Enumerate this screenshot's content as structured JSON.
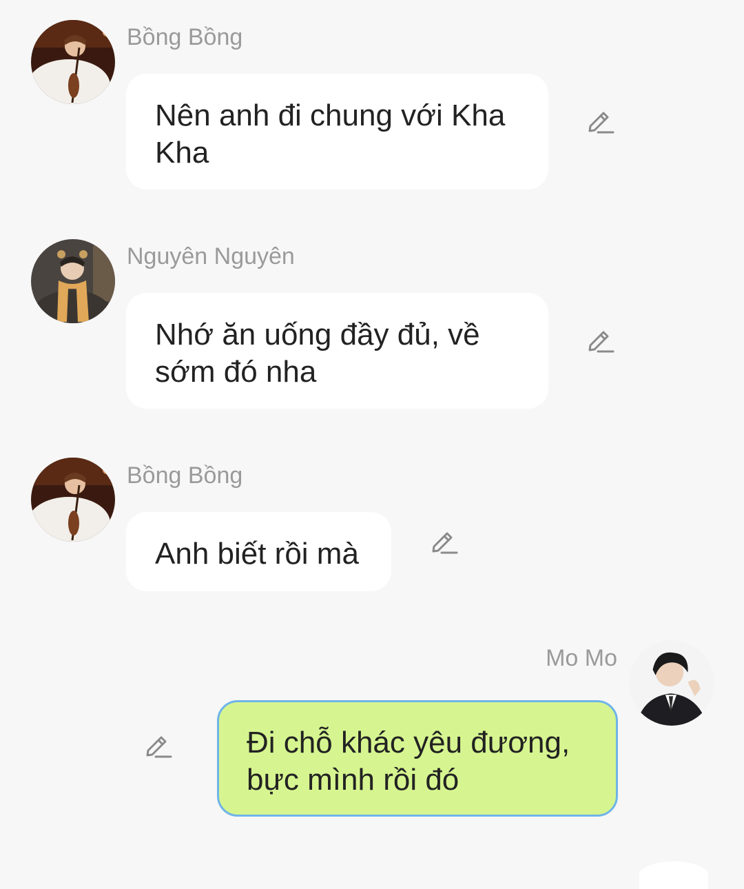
{
  "colors": {
    "background": "#f7f7f7",
    "incoming_bubble": "#ffffff",
    "outgoing_bubble": "#d6f590",
    "outgoing_border": "#6fb4e8",
    "sender_name": "#9a9a9a",
    "message_text": "#222222",
    "edit_icon": "#8a8a8a"
  },
  "messages": [
    {
      "sender": "Bồng Bồng",
      "text": "Nên anh đi chung với Kha Kha",
      "direction": "incoming",
      "avatar": "avatar-cellist-icon",
      "action_icon": "edit-pencil-icon"
    },
    {
      "sender": "Nguyên Nguyên",
      "text": "Nhớ ăn uống đầy đủ, về sớm đó nha",
      "direction": "incoming",
      "avatar": "avatar-scarf-icon",
      "action_icon": "edit-pencil-icon"
    },
    {
      "sender": "Bồng Bồng",
      "text": "Anh biết rồi mà",
      "direction": "incoming",
      "avatar": "avatar-cellist-icon",
      "action_icon": "edit-pencil-icon"
    },
    {
      "sender": "Mo Mo",
      "text": "Đi chỗ khác yêu đương, bực mình rồi đó",
      "direction": "outgoing",
      "avatar": "avatar-suit-icon",
      "action_icon": "edit-pencil-icon"
    }
  ]
}
